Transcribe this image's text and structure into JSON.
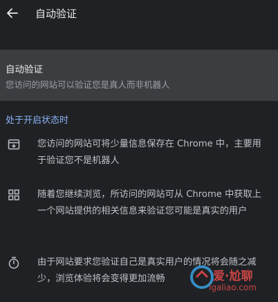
{
  "header": {
    "title": "自动验证"
  },
  "toggle": {
    "title": "自动验证",
    "subtitle": "您访问的网站可以验证您是真人而非机器人"
  },
  "section": {
    "heading": "处于开启状态时"
  },
  "items": [
    {
      "icon": "download-box-icon",
      "text": "您访问的网站可将少量信息保存在 Chrome 中，主要用于验证您不是机器人"
    },
    {
      "icon": "grid-icon",
      "text": "随着您继续浏览，所访问的网站可从 Chrome 中获取上一个网站提供的相关信息来验证您可能是真实的用户"
    },
    {
      "icon": "timer-icon",
      "text": "由于网站要求您验证自己是真实用户的情况将会随之减少，浏览体验将会变得更加流畅"
    }
  ],
  "watermark": {
    "logo_text": "爱·尬聊",
    "url": "igaliao.com"
  },
  "colors": {
    "background": "#202124",
    "card": "#3c3d40",
    "accent": "#8ab4f8",
    "watermark": "#e64c4c"
  }
}
